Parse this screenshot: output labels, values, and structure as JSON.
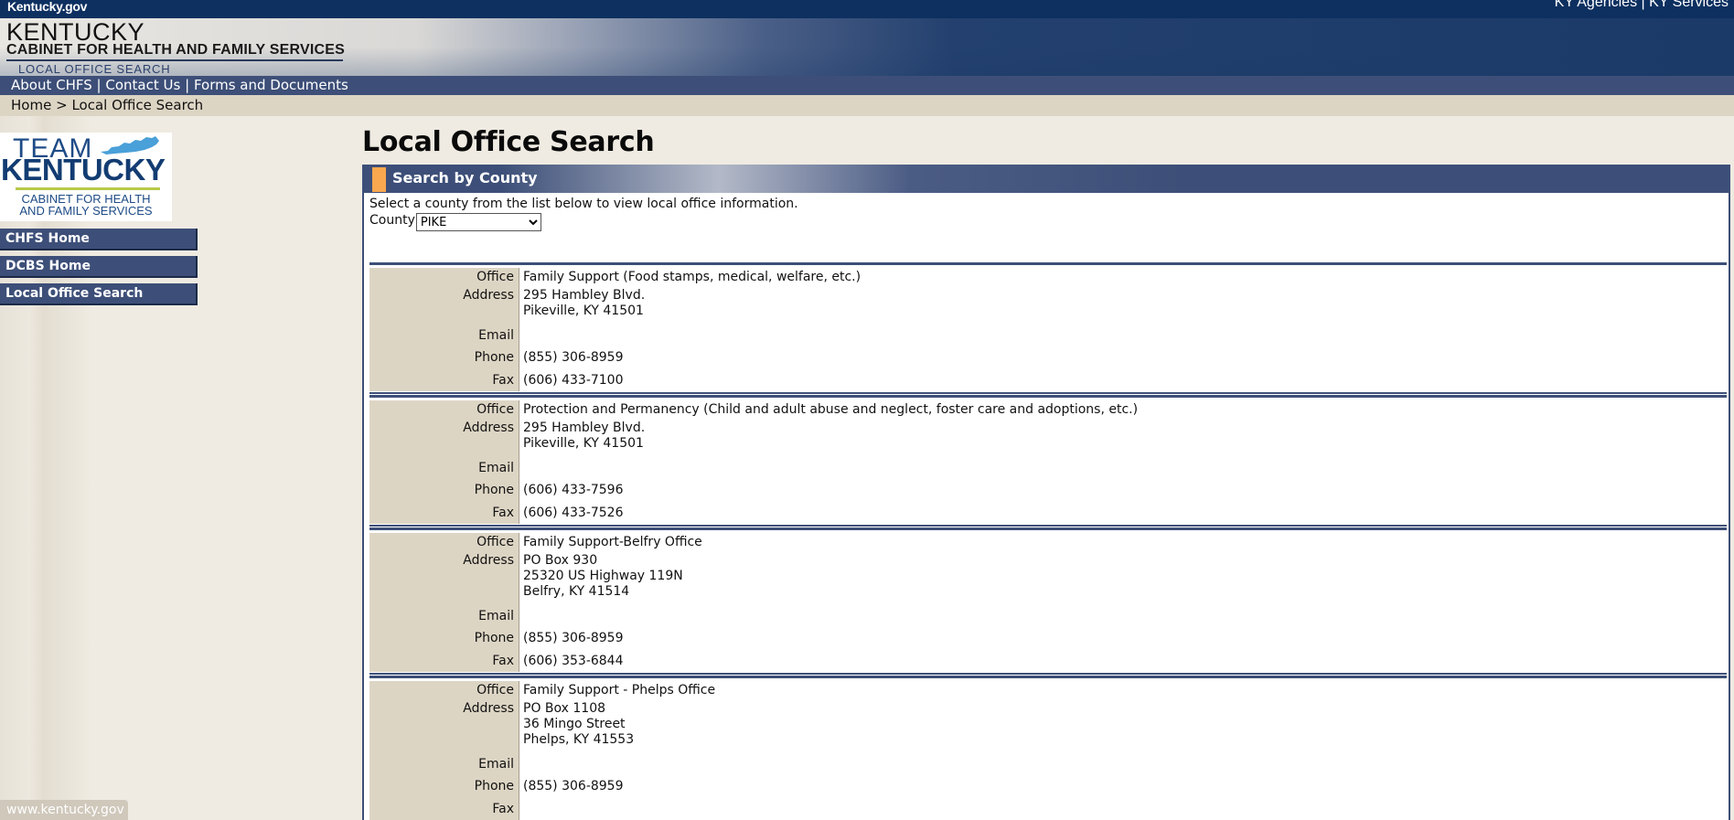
{
  "topbar": {
    "site": "Kentucky.gov",
    "link_agencies": "KY Agencies",
    "separator": "|",
    "link_services": "KY Services"
  },
  "banner": {
    "state": "KENTUCKY",
    "cabinet": "CABINET FOR HEALTH AND FAMILY SERVICES",
    "subtitle": "LOCAL OFFICE SEARCH"
  },
  "nav": {
    "about": "About CHFS",
    "sep": "|",
    "contact": "Contact Us",
    "forms": "Forms and Documents"
  },
  "breadcrumb": {
    "home": "Home",
    "sep": ">",
    "current": "Local Office Search"
  },
  "logo": {
    "team": "TEAM",
    "kentucky": "KENTUCKY",
    "line1": "CABINET FOR HEALTH",
    "line2": "AND FAMILY SERVICES",
    "colors": {
      "blue": "#1e4b86",
      "light_blue": "#4aa0d8",
      "green": "#b7c94a"
    }
  },
  "sidebar": {
    "items": [
      {
        "label": "CHFS Home"
      },
      {
        "label": "DCBS Home"
      },
      {
        "label": "Local Office Search"
      }
    ]
  },
  "footer": {
    "url": "www.kentucky.gov"
  },
  "main": {
    "title": "Local Office Search",
    "panel_title": "Search by County",
    "instructions": "Select a county from the list below to view local office information.",
    "county_label": "County",
    "county_selected": "PIKE"
  },
  "labels": {
    "office": "Office",
    "address": "Address",
    "email": "Email",
    "phone": "Phone",
    "fax": "Fax"
  },
  "offices": [
    {
      "office": "Family Support (Food stamps, medical, welfare, etc.)",
      "address": [
        "295 Hambley Blvd.",
        "Pikeville, KY  41501"
      ],
      "email": "",
      "phone": "(855) 306-8959",
      "fax": "(606) 433-7100"
    },
    {
      "office": "Protection and Permanency (Child and adult abuse and neglect, foster care and adoptions, etc.)",
      "address": [
        "295 Hambley Blvd.",
        "Pikeville, KY  41501"
      ],
      "email": "",
      "phone": "(606) 433-7596",
      "fax": "(606) 433-7526"
    },
    {
      "office": "Family Support-Belfry Office",
      "address": [
        "PO Box 930",
        "25320 US Highway 119N",
        "Belfry, KY  41514"
      ],
      "email": "",
      "phone": "(855) 306-8959",
      "fax": "(606) 353-6844"
    },
    {
      "office": "Family Support - Phelps Office",
      "address": [
        "PO Box 1108",
        "36 Mingo Street",
        "Phelps, KY  41553"
      ],
      "email": "",
      "phone": "(855) 306-8959",
      "fax": ""
    }
  ],
  "colors": {
    "nav_blue": "#3d4f78",
    "top_blue": "#0d3060",
    "label_bg": "#ddd5c4",
    "page_bg": "#efebe2",
    "accent_orange": "#f9a84f"
  }
}
